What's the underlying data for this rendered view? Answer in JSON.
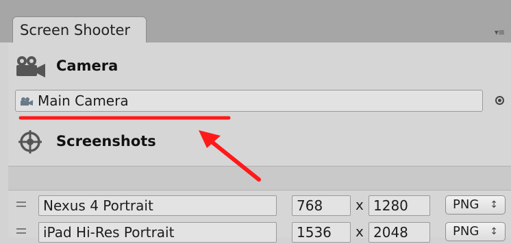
{
  "window": {
    "tab_title": "Screen Shooter",
    "tab_menu_icon": "▾≡"
  },
  "camera_section": {
    "title": "Camera",
    "icon": "camera-icon"
  },
  "camera_field": {
    "value": "Main Camera",
    "picker_icon": "object-picker-icon"
  },
  "screenshots_section": {
    "title": "Screenshots",
    "icon": "crosshair-icon"
  },
  "resolutions": [
    {
      "name": "Nexus 4 Portrait",
      "width": "768",
      "times": "x",
      "height": "1280",
      "format": "PNG",
      "format_arrows": "↕"
    },
    {
      "name": "iPad Hi-Res Portrait",
      "width": "1536",
      "times": "x",
      "height": "2048",
      "format": "PNG",
      "format_arrows": "↕"
    }
  ],
  "annotation": {
    "color": "#ff1a1a"
  }
}
